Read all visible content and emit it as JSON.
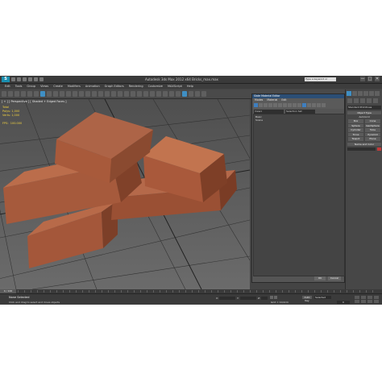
{
  "app": {
    "logo_text": "S",
    "title": "Autodesk 3ds Max 2012 x64    Bricks_max.max",
    "search_placeholder": "Type a keyword or phrase",
    "window_buttons": [
      "—",
      "□",
      "✕"
    ]
  },
  "menu": [
    "Edit",
    "Tools",
    "Group",
    "Views",
    "Create",
    "Modifiers",
    "Animation",
    "Graph Editors",
    "Rendering",
    "Customize",
    "MAXScript",
    "Help"
  ],
  "viewport": {
    "label": "[ + ] [ Perspective ] [ Shaded + Edged Faces ]",
    "stats": "Total\nPolys: 1,000\nVerts: 1,000\n\nFPS:  100.000"
  },
  "material_editor": {
    "title": "Slate Material Editor",
    "menu": [
      "Modes",
      "Material",
      "Edit",
      "Select",
      "View",
      "Options",
      "Tools",
      "Utilities"
    ],
    "field_left": "View1",
    "field_right": "Selection Set",
    "tree_items": [
      "Basic",
      "Scene"
    ],
    "ok_label": "OK",
    "cancel_label": "Cancel"
  },
  "command_panel": {
    "dropdown": "Standard Primitives",
    "section_object_type": "Object Type",
    "autogrid": "AutoGrid",
    "objects": [
      "Box",
      "Cone",
      "Sphere",
      "GeoSphere",
      "Cylinder",
      "Tube",
      "Torus",
      "Pyramid",
      "Teapot",
      "Plane"
    ],
    "section_name": "Name and Color"
  },
  "timeline": {
    "slider_label": "0 / 100"
  },
  "status": {
    "selection": "None Selected",
    "hint": "Click and drag to select and move objects",
    "x_label": "X:",
    "y_label": "Y:",
    "z_label": "Z:",
    "grid_label": "Grid = 10,0cm",
    "autokey_label": "Auto Key",
    "set_key_dropdown": "Selected",
    "frame_value": "0"
  },
  "colors": {
    "accent": "#3f8fc4",
    "viewport_bg": "#5d5d5d",
    "brick": "#a4573a",
    "stats_text": "#f0d040"
  }
}
